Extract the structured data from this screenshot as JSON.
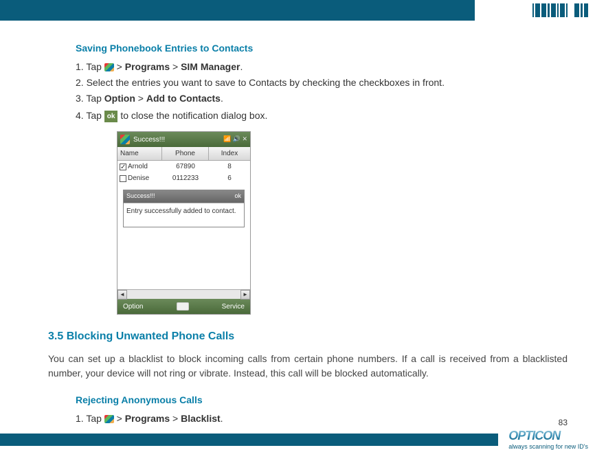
{
  "section1": {
    "title": "Saving Phonebook Entries to Contacts",
    "step1_prefix": "1. Tap ",
    "step1_gt1": " > ",
    "step1_programs": "Programs",
    "step1_gt2": " > ",
    "step1_sim": "SIM Manager",
    "step1_dot": ".",
    "step2": "2. Select the entries you want to save to Contacts by checking the checkboxes in front.",
    "step3_prefix": "3. Tap ",
    "step3_option": "Option",
    "step3_gt": " > ",
    "step3_add": "Add to Contacts",
    "step3_dot": ".",
    "step4_prefix": "4. Tap ",
    "step4_ok": "ok",
    "step4_suffix": " to close the notification dialog box."
  },
  "screenshot": {
    "title": "Success!!!",
    "col_name": "Name",
    "col_phone": "Phone",
    "col_index": "Index",
    "rows": [
      {
        "name": "Arnold",
        "phone": "67890",
        "index": "8",
        "checked": true
      },
      {
        "name": "Denise",
        "phone": "0112233",
        "index": "6",
        "checked": false
      }
    ],
    "dialog_title": "Success!!!",
    "dialog_ok": "ok",
    "dialog_msg": "Entry successfully added to contact.",
    "bottom_left": "Option",
    "bottom_right": "Service"
  },
  "section2": {
    "title": "3.5 Blocking Unwanted Phone Calls",
    "body": "You can set up a blacklist to block incoming calls from certain phone numbers. If a call is received from a blacklisted number, your device will not ring or vibrate. Instead, this call will be blocked automatically."
  },
  "section3": {
    "title": "Rejecting Anonymous Calls",
    "step1_prefix": "1. Tap ",
    "step1_gt1": " > ",
    "step1_programs": "Programs",
    "step1_gt2": " > ",
    "step1_blacklist": "Blacklist",
    "step1_dot": "."
  },
  "footer": {
    "page": "83",
    "logo": "OPTICON",
    "tagline": "always scanning for new ID's"
  }
}
